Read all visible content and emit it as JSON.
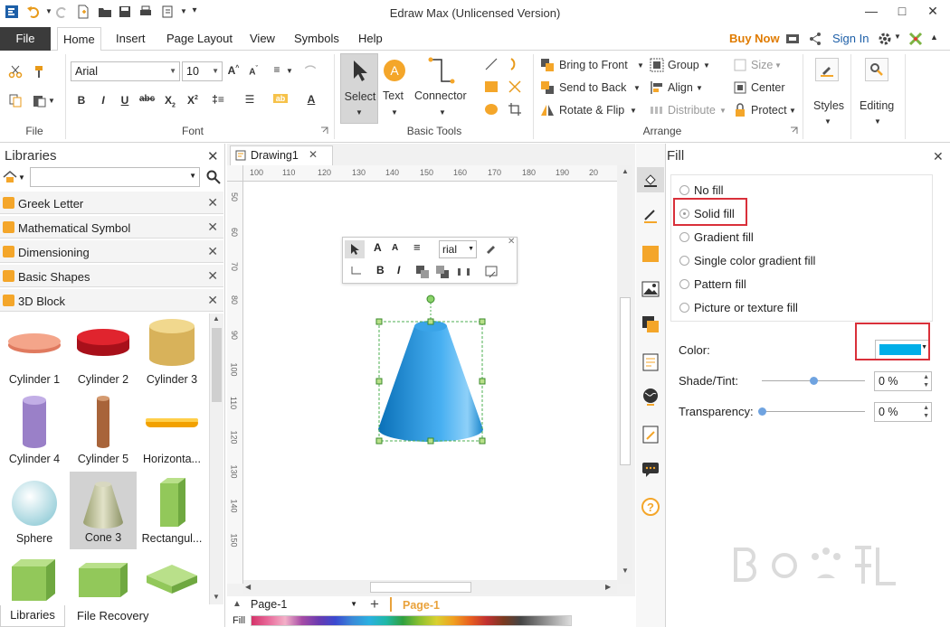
{
  "app": {
    "title": "Edraw Max (Unlicensed Version)"
  },
  "menu": {
    "file": "File",
    "tabs": [
      "Home",
      "Insert",
      "Page Layout",
      "View",
      "Symbols",
      "Help"
    ],
    "buy_now": "Buy Now",
    "sign_in": "Sign In"
  },
  "ribbon": {
    "font_name": "Arial",
    "font_size": "10",
    "groups": {
      "file": "File",
      "font": "Font",
      "basic_tools": "Basic Tools",
      "arrange": "Arrange"
    },
    "tools": {
      "select": "Select",
      "text": "Text",
      "connector": "Connector"
    },
    "arrange": {
      "bring_front": "Bring to Front",
      "send_back": "Send to Back",
      "rotate_flip": "Rotate & Flip",
      "group": "Group",
      "align": "Align",
      "distribute": "Distribute",
      "size": "Size",
      "center": "Center",
      "protect": "Protect"
    },
    "styles": "Styles",
    "editing": "Editing"
  },
  "libraries": {
    "title": "Libraries",
    "items": [
      "Greek Letter",
      "Mathematical Symbol",
      "Dimensioning",
      "Basic Shapes",
      "3D Block"
    ],
    "shapes": [
      "Cylinder 1",
      "Cylinder 2",
      "Cylinder 3",
      "Cylinder 4",
      "Cylinder 5",
      "Horizonta...",
      "Sphere",
      "Cone 3",
      "Rectangul..."
    ],
    "bottom_tabs": [
      "Libraries",
      "File Recovery"
    ]
  },
  "document": {
    "tab": "Drawing1",
    "ruler_h": [
      "100",
      "110",
      "120",
      "130",
      "140",
      "150",
      "160",
      "170",
      "180",
      "190",
      "20"
    ],
    "ruler_v": [
      "50",
      "60",
      "70",
      "80",
      "90",
      "100",
      "110",
      "120",
      "130",
      "140",
      "150"
    ],
    "mini_font": "rial",
    "page_select": "Page-1",
    "page_tab": "Page-1",
    "fill_label": "Fill"
  },
  "fill_panel": {
    "title": "Fill",
    "options": [
      "No fill",
      "Solid fill",
      "Gradient fill",
      "Single color gradient fill",
      "Pattern fill",
      "Picture or texture fill"
    ],
    "color_label": "Color:",
    "color_value": "#00aee8",
    "shade_label": "Shade/Tint:",
    "shade_value": "0 %",
    "shade_level": 0.5,
    "transparency_label": "Transparency:",
    "transparency_value": "0 %",
    "transparency_level": 0
  },
  "colors": {
    "accent": "#3b3b3b",
    "buy_now": "#e07b00",
    "highlight": "#d9303a",
    "page_tab": "#e9a23b"
  }
}
